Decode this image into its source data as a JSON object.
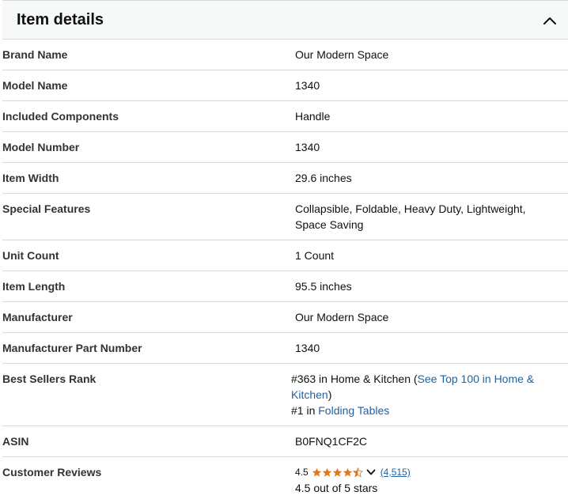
{
  "header": {
    "title": "Item details"
  },
  "rows": {
    "brand": {
      "label": "Brand Name",
      "value": "Our Modern Space"
    },
    "model_name": {
      "label": "Model Name",
      "value": "1340"
    },
    "included": {
      "label": "Included Components",
      "value": "Handle"
    },
    "model_number": {
      "label": "Model Number",
      "value": "1340"
    },
    "width": {
      "label": "Item Width",
      "value": "29.6 inches"
    },
    "features": {
      "label": "Special Features",
      "value": "Collapsible, Foldable, Heavy Duty, Lightweight, Space Saving"
    },
    "unit_count": {
      "label": "Unit Count",
      "value": "1 Count"
    },
    "length": {
      "label": "Item Length",
      "value": "95.5 inches"
    },
    "manufacturer": {
      "label": "Manufacturer",
      "value": "Our Modern Space"
    },
    "part_number": {
      "label": "Manufacturer Part Number",
      "value": "1340"
    },
    "bsr": {
      "label": "Best Sellers Rank",
      "rank1": "#363 in Home & Kitchen (",
      "rank1_link": "See Top 100 in Home & Kitchen",
      "rank1_close": ")",
      "rank2": "#1 in ",
      "rank2_link": "Folding Tables"
    },
    "asin": {
      "label": "ASIN",
      "value": "B0FNQ1CF2C"
    },
    "reviews": {
      "label": "Customer Reviews",
      "rating": "4.5",
      "count": "(4,515)",
      "summary": "4.5 out of 5 stars"
    }
  },
  "colors": {
    "star": "#de7921",
    "link": "#2162a1",
    "divider": "#d5d9d9",
    "header_bg": "#f7f8f8"
  }
}
